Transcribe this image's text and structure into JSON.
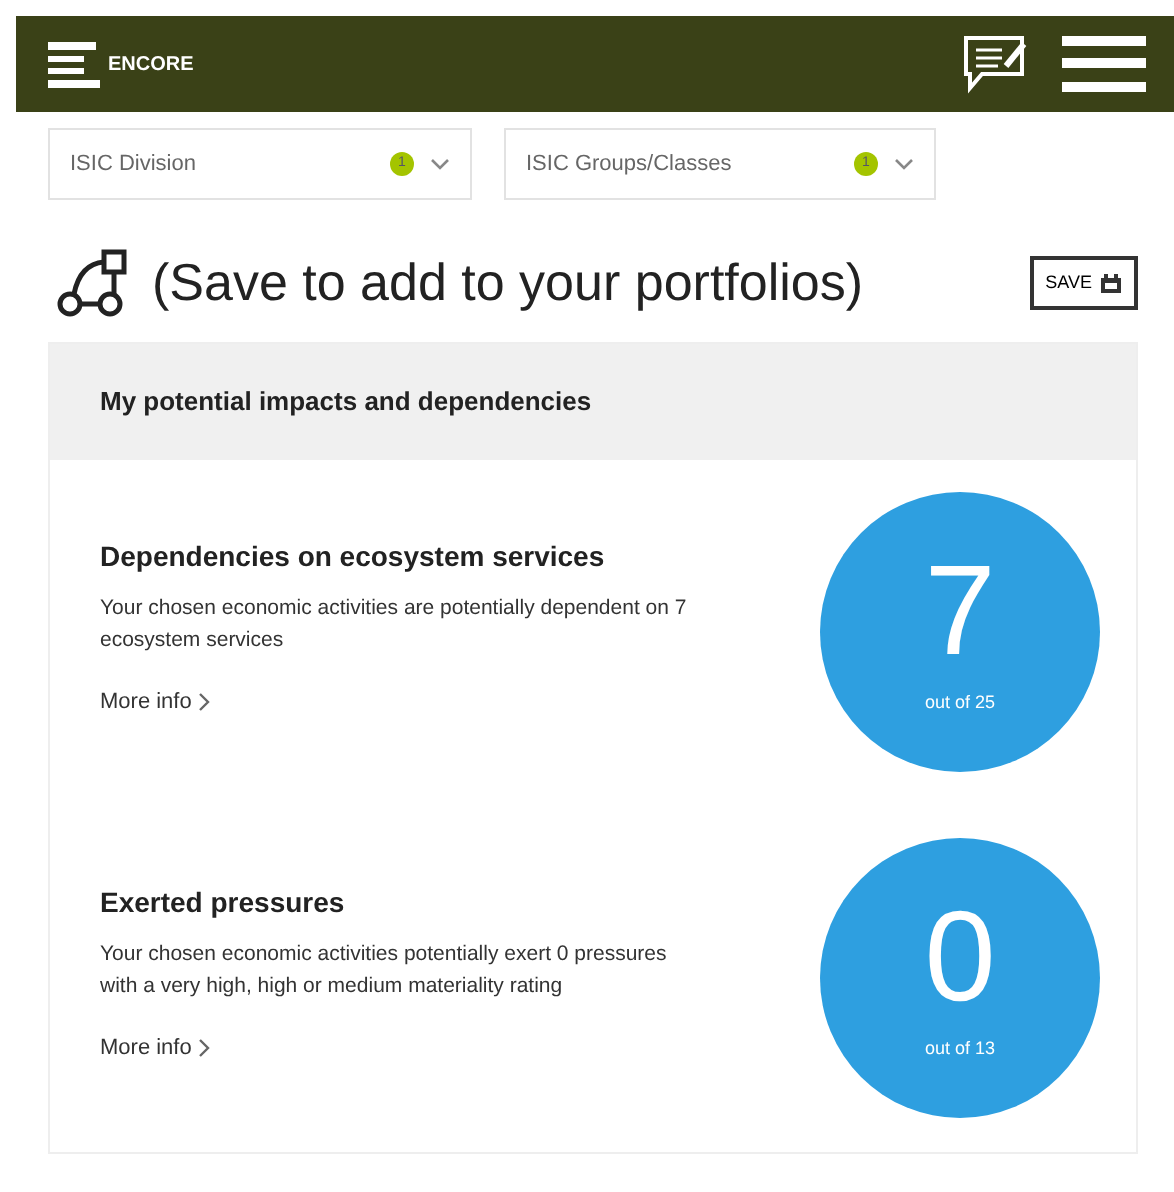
{
  "header": {
    "brand": "ENCORE"
  },
  "filters": [
    {
      "label": "ISIC Division",
      "count": "1"
    },
    {
      "label": "ISIC Groups/Classes",
      "count": "1"
    }
  ],
  "title": "(Save to add to your portfolios)",
  "save_button": "SAVE",
  "panel": {
    "heading": "My potential impacts and dependencies",
    "items": [
      {
        "title": "Dependencies on ecosystem services",
        "text": "Your chosen economic activities are potentially dependent on 7 ecosystem services",
        "link": "More info",
        "value": "7",
        "caption": "out of 25"
      },
      {
        "title": "Exerted pressures",
        "text": "Your chosen economic activities potentially exert 0 pressures with a very high, high or medium materiality rating",
        "link": "More info",
        "value": "0",
        "caption": "out of 13"
      }
    ]
  }
}
